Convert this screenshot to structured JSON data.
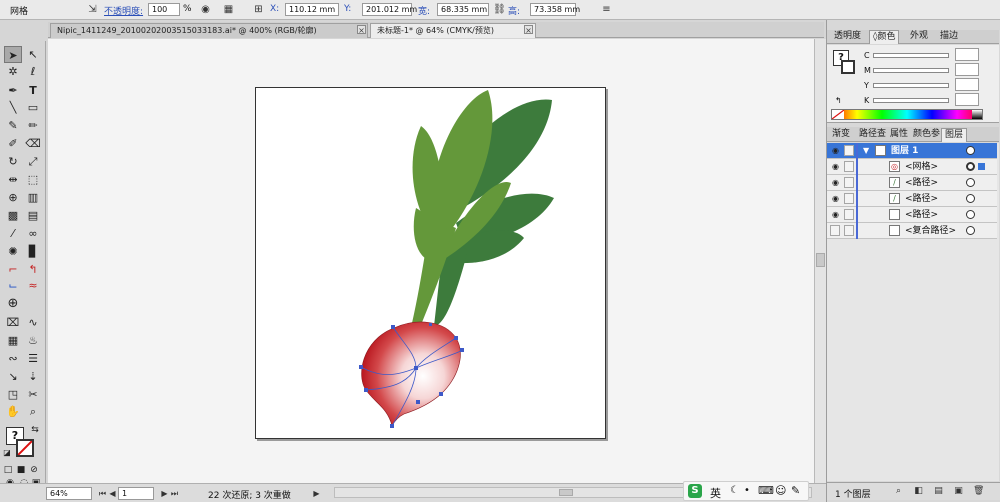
{
  "control_bar": {
    "tool_name": "网格",
    "opacity_label": "不透明度:",
    "opacity_value": "100",
    "opacity_unit": "%",
    "x_label": "X:",
    "x_value": "110.12 mm",
    "y_label": "Y:",
    "y_value": "201.012 mm",
    "w_label": "宽:",
    "w_value": "68.335 mm",
    "h_label": "高:",
    "h_value": "73.358 mm"
  },
  "doc_tabs": [
    {
      "label": "Nipic_1411249_20100202003515033183.ai* @ 400% (RGB/轮廓)",
      "active": false
    },
    {
      "label": "未标题-1* @ 64% (CMYK/预览)",
      "active": true
    }
  ],
  "status_bar": {
    "zoom": "64%",
    "page": "1",
    "message": "22 次还原; 3 次重做"
  },
  "color_panel": {
    "tabs": [
      "透明度",
      "颜色",
      "外观",
      "描边"
    ],
    "active_tab": "颜色",
    "channels": [
      "C",
      "M",
      "Y",
      "K"
    ]
  },
  "layers_panel": {
    "tabs": [
      "渐变",
      "路径查",
      "属性",
      "颜色参",
      "图层"
    ],
    "active_tab": "图层",
    "layer_name": "图层 1",
    "items": [
      "<网格>",
      "<路径>",
      "<路径>",
      "<路径>",
      "<复合路径>"
    ],
    "footer_count": "1 个图层"
  },
  "ime": {
    "label": "英"
  },
  "colors": {
    "leaf_light": "#64983a",
    "leaf_dark": "#3d7b3c",
    "radish_red": "#c4272c",
    "selection_blue": "#3875d7",
    "anchor_blue": "#3d59c8"
  }
}
